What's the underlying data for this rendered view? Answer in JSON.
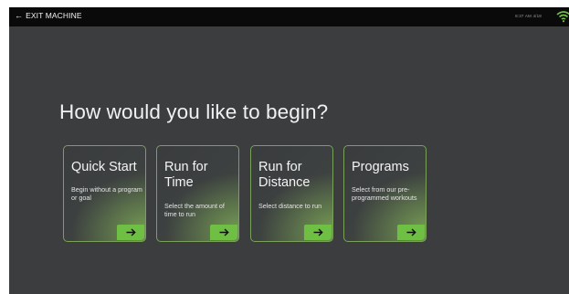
{
  "topbar": {
    "exit_label": "EXIT MACHINE",
    "status_time": "8:37 AM 4/18"
  },
  "main": {
    "headline": "How would you like to begin?"
  },
  "cards": [
    {
      "title": "Quick Start",
      "description": "Begin without a program or goal"
    },
    {
      "title": "Run for Time",
      "description": "Select the amount of time to run"
    },
    {
      "title": "Run for Distance",
      "description": "Select distance to run"
    },
    {
      "title": "Programs",
      "description": "Select from our pre-programmed workouts"
    }
  ],
  "icons": {
    "exit": "left-arrow-icon",
    "wifi": "wifi-icon",
    "card_arrow": "right-arrow-icon"
  },
  "colors": {
    "background": "#3b3d3f",
    "topbar": "#0a0a0a",
    "accent": "#6fbf45",
    "card_border": "#7aa05a"
  }
}
